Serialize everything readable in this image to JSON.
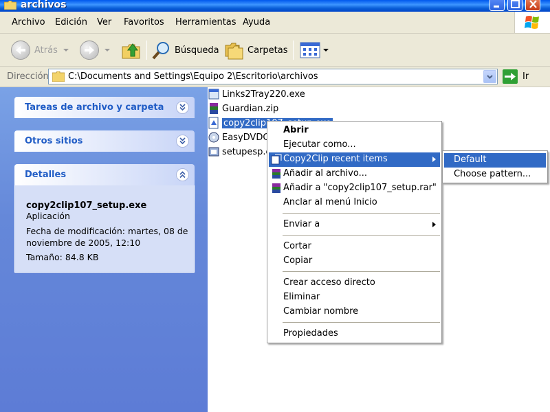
{
  "window": {
    "title": "archivos"
  },
  "menubar": {
    "items": [
      "Archivo",
      "Edición",
      "Ver",
      "Favoritos",
      "Herramientas",
      "Ayuda"
    ]
  },
  "toolbar": {
    "back_label": "Atrás",
    "search_label": "Búsqueda",
    "folders_label": "Carpetas"
  },
  "address": {
    "label": "Dirección",
    "path": "C:\\Documents and Settings\\Equipo 2\\Escritorio\\archivos",
    "go_label": "Ir"
  },
  "taskpane": {
    "file_tasks_title": "Tareas de archivo y carpeta",
    "other_places_title": "Otros sitios",
    "details_title": "Detalles",
    "details": {
      "name": "copy2clip107_setup.exe",
      "type": "Aplicación",
      "modified_line1": "Fecha de modificación: martes, 08 de",
      "modified_line2": "noviembre de 2005, 12:10",
      "size": "Tamaño: 84.8 KB"
    }
  },
  "files": [
    {
      "name": "Links2Tray220.exe",
      "icon": "exe-icon"
    },
    {
      "name": "Guardian.zip",
      "icon": "rar-archive-icon"
    },
    {
      "name": "copy2clip107_setup.exe",
      "icon": "setup-exe-icon",
      "selected": true
    },
    {
      "name": "EasyDVDCl",
      "icon": "exe-icon"
    },
    {
      "name": "setupesp.e",
      "icon": "exe-icon"
    }
  ],
  "context_menu": {
    "open": "Abrir",
    "run_as": "Ejecutar como...",
    "copy2clip": "Copy2Clip recent items",
    "add_archive": "Añadir al archivo...",
    "add_rar": "Añadir a \"copy2clip107_setup.rar\"",
    "pin_start": "Anclar al menú Inicio",
    "send_to": "Enviar a",
    "cut": "Cortar",
    "copy": "Copiar",
    "shortcut": "Crear acceso directo",
    "delete": "Eliminar",
    "rename": "Cambiar nombre",
    "properties": "Propiedades"
  },
  "submenu": {
    "items": [
      "Default",
      "Choose pattern..."
    ]
  },
  "colors": {
    "selection": "#316ac5",
    "taskpane_bg": "#6f93e0",
    "panel_title": "#215dc6"
  }
}
